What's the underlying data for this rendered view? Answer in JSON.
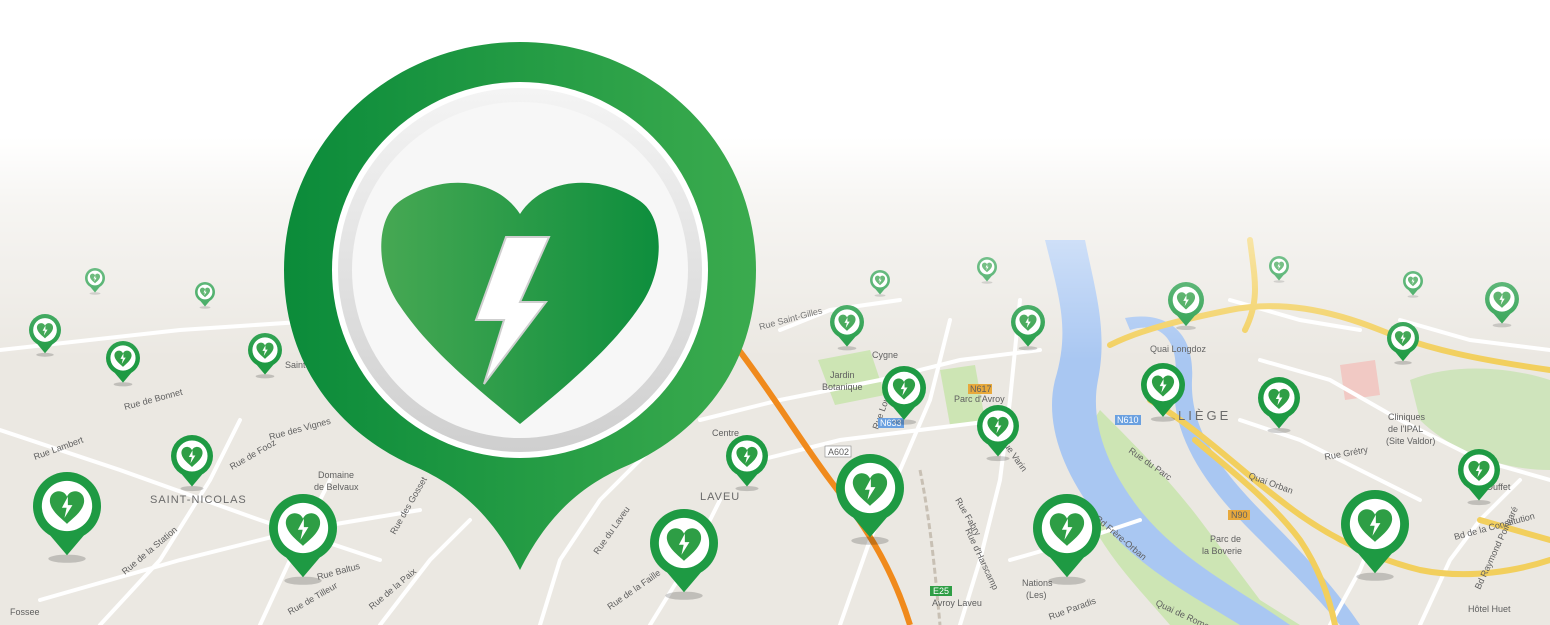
{
  "colors": {
    "marker_green": "#2e9e45",
    "marker_green_dark": "#0b8b3a",
    "heart_green": "#3a9f4a",
    "river": "#a9c7f2",
    "main_road": "#f2cf5d",
    "motorway": "#f08a1c",
    "park": "#cde5b4",
    "land": "#ebe8e2"
  },
  "hero_marker": {
    "icon": "aed-heart-lightning-icon"
  },
  "map_markers_icon": "aed-heart-lightning-icon",
  "map_labels": {
    "saint_nicolas": "SAINT-NICOLAS",
    "laveu": "LAVEU",
    "liege": "LIÈGE",
    "domaine": "Domaine",
    "de_belvaux": "de Belvaux",
    "jardin": "Jardin",
    "botanique": "Botanique",
    "cygne": "Cygne",
    "parc_avroy": "Parc d'Avroy",
    "parc_de": "Parc de",
    "la_boverie": "la Boverie",
    "nations": "Nations",
    "nations_sub": "(Les)",
    "avroy_laveu": "Avroy Laveu",
    "hotel_huet": "Hôtel Huet",
    "quai_orban": "Quai Orban",
    "quai_de_rome": "Quai de Rome",
    "blvd_frere_orban": "Bd Frère-Orban",
    "rue_du_parc": "Rue du Parc",
    "rue_paradis": "Rue Paradis",
    "rue_laveu": "Rue du Laveu",
    "rue_de_la_faille": "Rue de la Faille",
    "rue_baltus": "Rue Baltus",
    "rue_de_tilleur": "Rue de Tilleur",
    "rue_de_la_paix": "Rue de la Paix",
    "rue_de_bonnet": "Rue de Bonnet",
    "rue_de_fooz": "Rue de Fooz",
    "rue_des_vignes": "Rue des Vignes",
    "rue_des_gosset": "Rue des Gosset",
    "rue_fabry": "Rue Fabry",
    "rue_d_harscamp": "Rue d'Harscamp",
    "rue_louvrex": "Rue Louvrex",
    "rue_gretry": "Rue Grétry",
    "bd_de_la_constitution": "Bd de la Constitution",
    "bd_raymond_poincare": "Bd Raymond Poincaré",
    "rue_saint_gilles": "Rue Saint-Gilles",
    "rue_varin": "Rue Varin",
    "road_a602": "A602",
    "road_n617": "N617",
    "road_n90": "N90",
    "road_n633": "N633",
    "road_n610": "N610",
    "road_e25": "E25",
    "centre": "Centre",
    "saint_cme": "Saint",
    "quai_longdoz": "Quai Longdoz",
    "clinique": "Cliniques",
    "clinique2": "de l'IPAL",
    "clinique3": "(Site Valdor)",
    "ouffet": "Ouffet",
    "rue_lambert": "Rue Lambert",
    "rue_de_la_station": "Rue de la Station",
    "fosse": "Fossee"
  }
}
